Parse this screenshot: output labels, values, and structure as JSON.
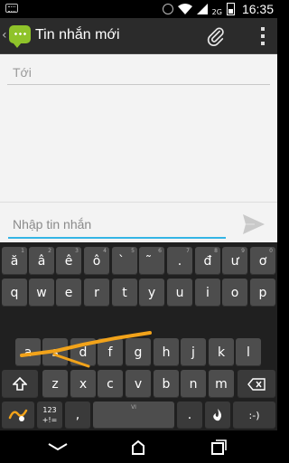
{
  "status_bar": {
    "network_label": "2G",
    "time": "16:35"
  },
  "action_bar": {
    "title": "Tin nhắn mới"
  },
  "compose": {
    "to_placeholder": "Tới",
    "message_placeholder": "Nhập tin nhắn"
  },
  "keyboard": {
    "row1": [
      "ă",
      "â",
      "ê",
      "ô",
      "̀",
      "̃",
      ".",
      "đ",
      "ư",
      "ơ"
    ],
    "row1_hints": [
      "1",
      "2",
      "3",
      "4",
      "5",
      "6",
      "7",
      "8",
      "9",
      "0"
    ],
    "row2": [
      "q",
      "w",
      "e",
      "r",
      "t",
      "y",
      "u",
      "i",
      "o",
      "p"
    ],
    "row3": [
      "a",
      "s",
      "d",
      "f",
      "g",
      "h",
      "j",
      "k",
      "l"
    ],
    "row4": [
      "z",
      "x",
      "c",
      "v",
      "b",
      "n",
      "m"
    ],
    "symbols_top": "123",
    "symbols_bottom": "+!=",
    "comma": ",",
    "space_label": "VI",
    "period": ".",
    "smiley": ":-)"
  },
  "colors": {
    "accent": "#33b5e5",
    "app_icon": "#8fc32a",
    "swipe": "#f2a31a"
  }
}
